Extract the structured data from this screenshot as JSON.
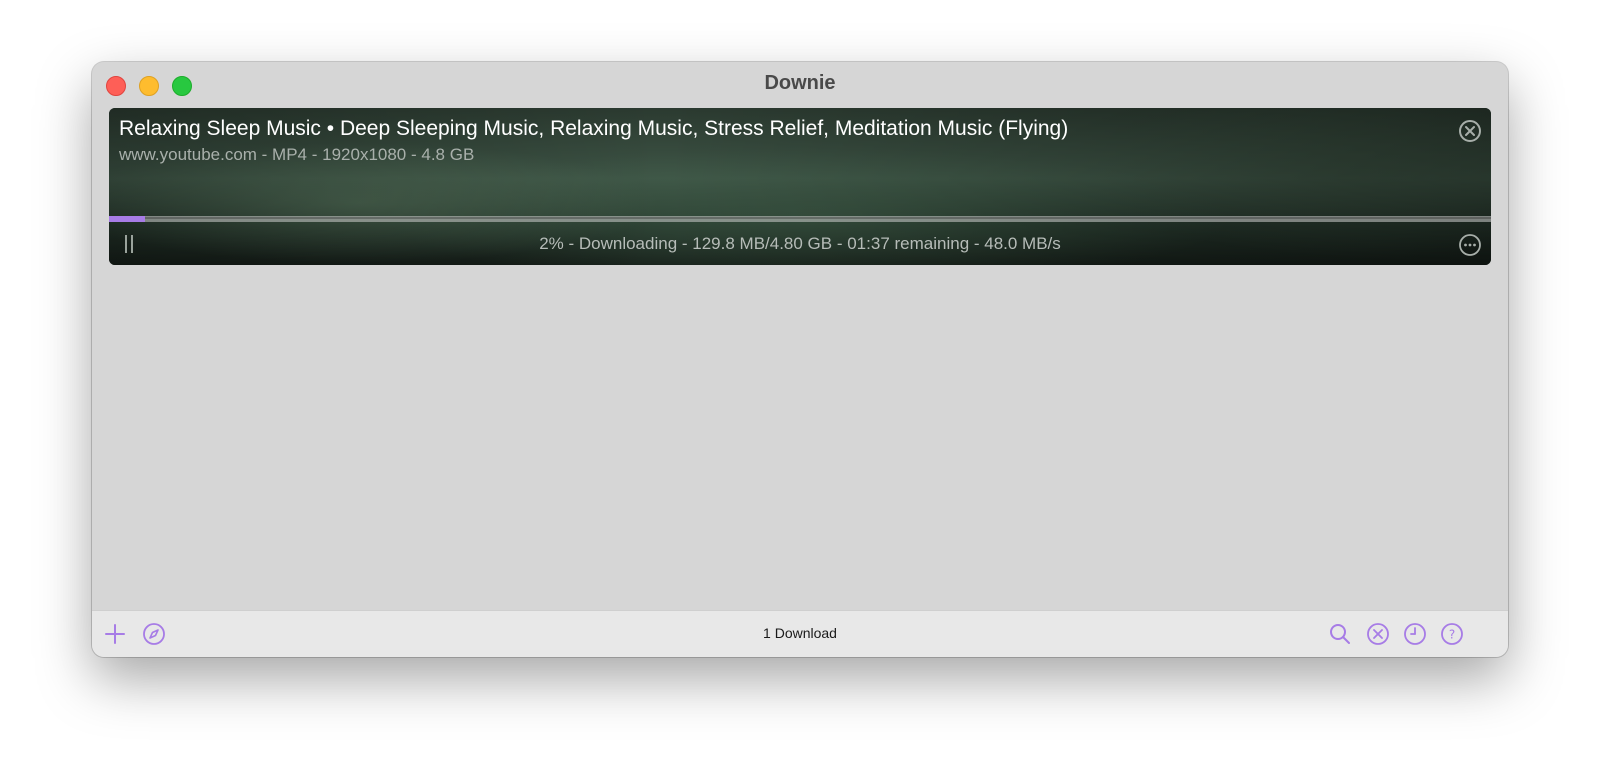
{
  "window": {
    "title": "Downie"
  },
  "downloads": [
    {
      "title": "Relaxing Sleep Music • Deep Sleeping Music, Relaxing Music, Stress Relief, Meditation Music (Flying)",
      "meta": "www.youtube.com - MP4 - 1920x1080 - 4.8 GB",
      "progress_percent": 2.6,
      "status": "2% - Downloading - 129.8 MB/4.80 GB - 01:37 remaining - 48.0 MB/s"
    }
  ],
  "footer": {
    "status": "1 Download",
    "icons": [
      "plus-icon",
      "compass-icon",
      "search-icon",
      "clear-icon",
      "history-icon",
      "help-icon"
    ]
  },
  "colors": {
    "accent": "#a77ce6",
    "window_bg": "#d6d6d6",
    "footer_bg": "#e8e8e8"
  }
}
